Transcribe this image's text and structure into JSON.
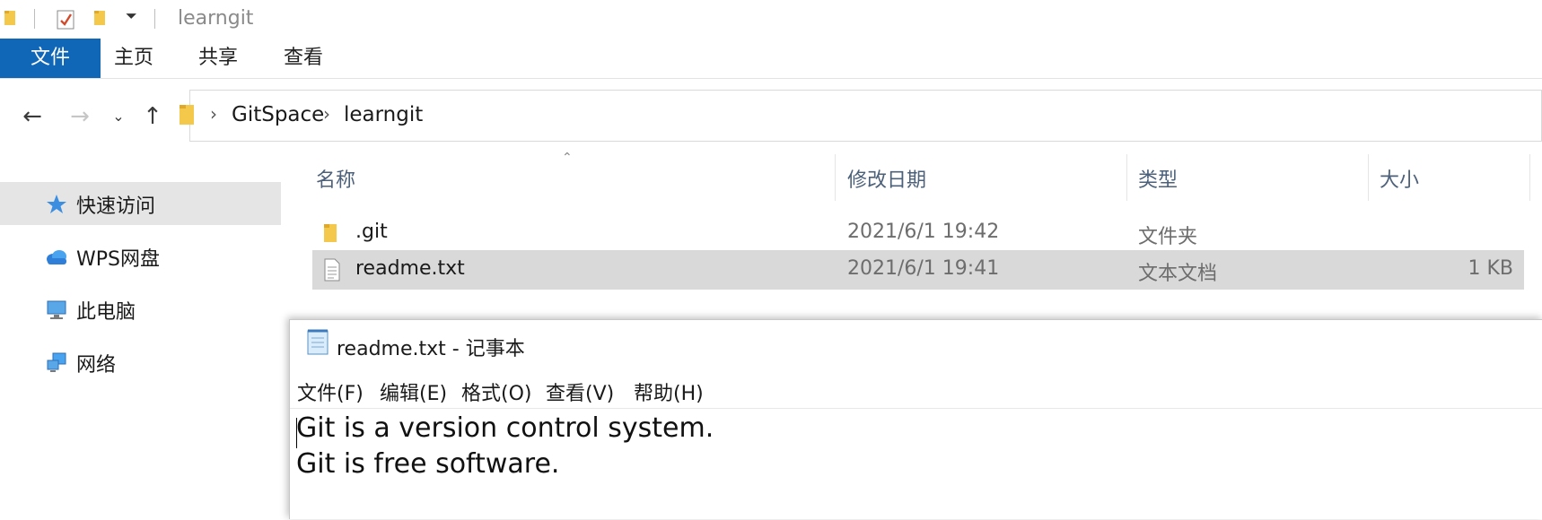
{
  "window": {
    "title": "learngit"
  },
  "ribbon": {
    "tabs": [
      "文件",
      "主页",
      "共享",
      "查看"
    ]
  },
  "address": {
    "crumbs": [
      "GitSpace",
      "learngit"
    ]
  },
  "sidebar": {
    "items": [
      {
        "label": "快速访问",
        "icon": "star-icon",
        "active": true
      },
      {
        "label": "WPS网盘",
        "icon": "cloud-icon",
        "active": false
      },
      {
        "label": "此电脑",
        "icon": "computer-icon",
        "active": false
      },
      {
        "label": "网络",
        "icon": "network-icon",
        "active": false
      }
    ]
  },
  "filelist": {
    "columns": [
      "名称",
      "修改日期",
      "类型",
      "大小"
    ],
    "rows": [
      {
        "name": ".git",
        "date": "2021/6/1 19:42",
        "type": "文件夹",
        "size": "",
        "icon": "folder-icon",
        "selected": false
      },
      {
        "name": "readme.txt",
        "date": "2021/6/1 19:41",
        "type": "文本文档",
        "size": "1 KB",
        "icon": "text-file-icon",
        "selected": true
      }
    ]
  },
  "notepad": {
    "title": "readme.txt - 记事本",
    "menu": [
      "文件(F)",
      "编辑(E)",
      "格式(O)",
      "查看(V)",
      "帮助(H)"
    ],
    "lines": [
      "Git is a version control system.",
      "Git is free software."
    ]
  },
  "colors": {
    "accent": "#1167b7",
    "folder": "#f4c84a",
    "selection": "#d9d9d9"
  }
}
